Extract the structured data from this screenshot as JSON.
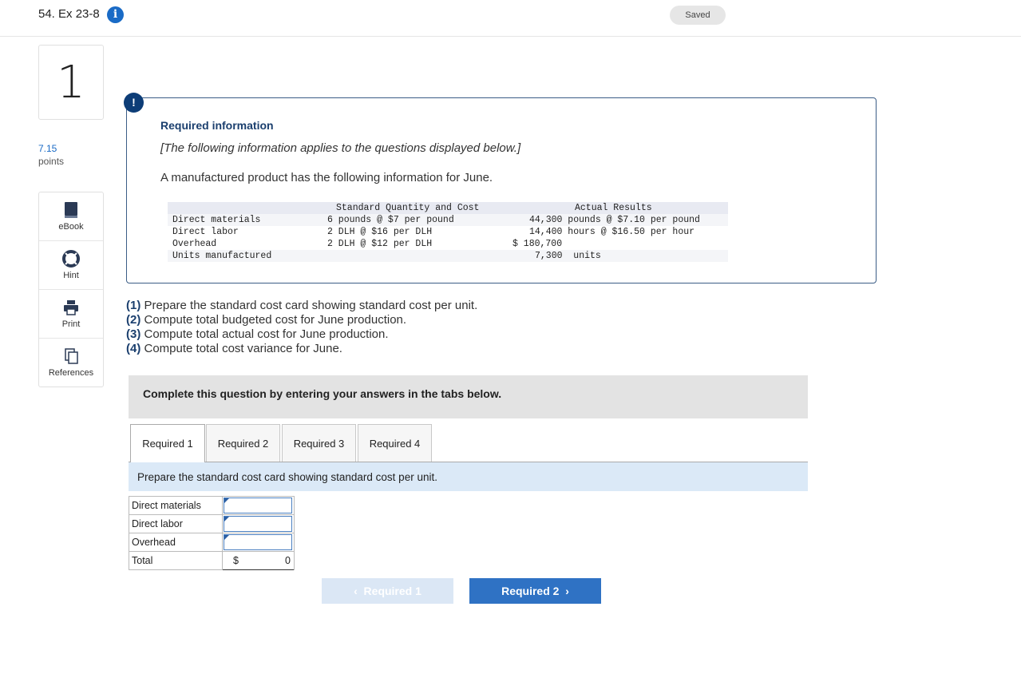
{
  "header": {
    "title": "54. Ex 23-8",
    "info_icon": "info-icon",
    "saved": "Saved"
  },
  "question": {
    "number": "1",
    "points_value": "7.15",
    "points_label": "points"
  },
  "tools": [
    {
      "label": "eBook",
      "icon": "book-icon"
    },
    {
      "label": "Hint",
      "icon": "lifebuoy-icon"
    },
    {
      "label": "Print",
      "icon": "printer-icon"
    },
    {
      "label": "References",
      "icon": "copy-icon"
    }
  ],
  "required_info": {
    "heading": "Required information",
    "note": "[The following information applies to the questions displayed below.]",
    "intro": "A manufactured product has the following information for June.",
    "col_standard": "Standard Quantity and Cost",
    "col_actual": "Actual Results",
    "rows": [
      {
        "label": "Direct materials",
        "standard": "6 pounds @ $7 per pound",
        "actual": "44,300 pounds @ $7.10 per pound"
      },
      {
        "label": "Direct labor",
        "standard": "2 DLH @ $16 per DLH",
        "actual": "14,400 hours @ $16.50 per hour"
      },
      {
        "label": "Overhead",
        "standard": "2 DLH @ $12 per DLH",
        "actual": "$ 180,700"
      },
      {
        "label": "Units manufactured",
        "standard": "",
        "actual": "7,300  units"
      }
    ]
  },
  "questions": [
    {
      "num": "(1)",
      "text": " Prepare the standard cost card showing standard cost per unit."
    },
    {
      "num": "(2)",
      "text": " Compute total budgeted cost for June production."
    },
    {
      "num": "(3)",
      "text": " Compute total actual cost for June production."
    },
    {
      "num": "(4)",
      "text": " Compute total cost variance for June."
    }
  ],
  "complete_banner": "Complete this question by entering your answers in the tabs below.",
  "tabs": [
    "Required 1",
    "Required 2",
    "Required 3",
    "Required 4"
  ],
  "active_tab": "Required 1",
  "instruction": "Prepare the standard cost card showing standard cost per unit.",
  "answer_table": {
    "rows": [
      {
        "label": "Direct materials",
        "value": ""
      },
      {
        "label": "Direct labor",
        "value": ""
      },
      {
        "label": "Overhead",
        "value": ""
      }
    ],
    "total_label": "Total",
    "total_currency": "$",
    "total_value": "0"
  },
  "nav": {
    "prev_label": "Required 1",
    "next_label": "Required 2"
  },
  "colors": {
    "accent": "#2f72c4",
    "heading": "#1b3f6e",
    "instruction_bg": "#dbe9f7"
  }
}
